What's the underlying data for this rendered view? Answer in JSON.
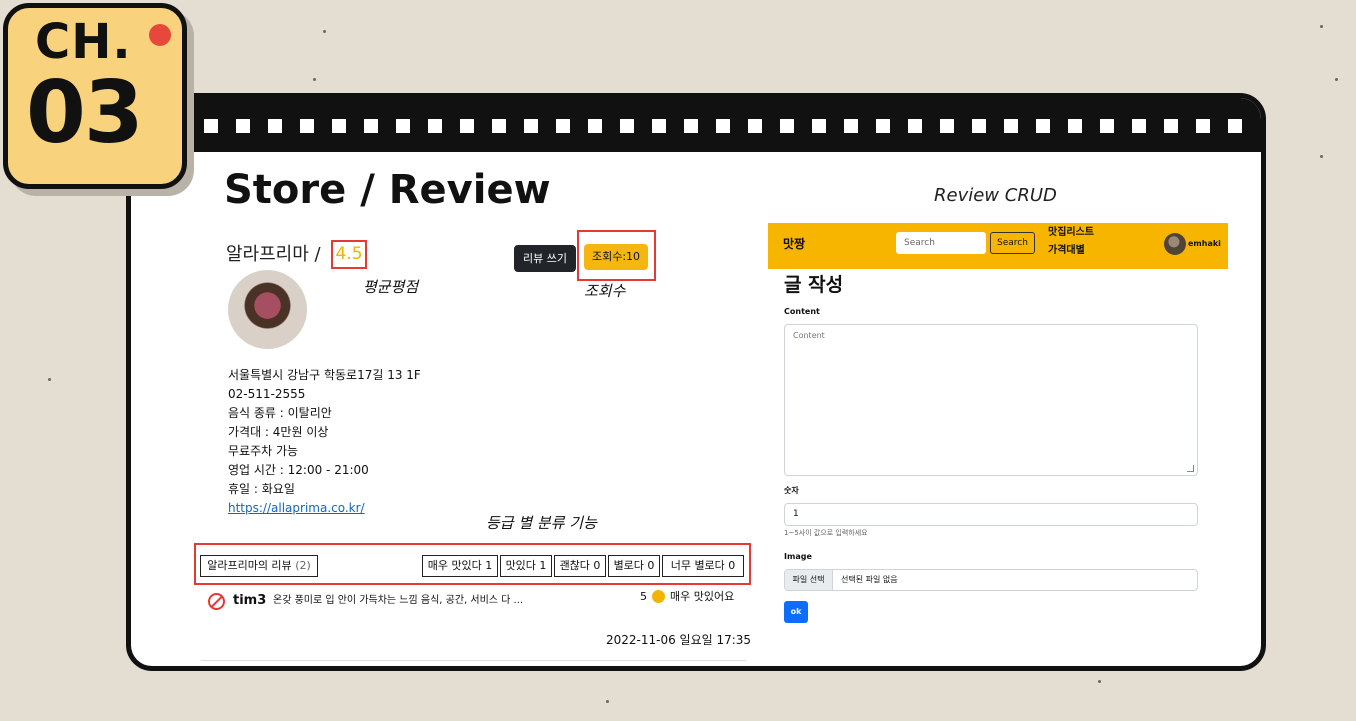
{
  "badge": {
    "chapter": "CH.",
    "number": "03"
  },
  "slide": {
    "title": "Store / Review",
    "crud_caption": "Review CRUD"
  },
  "store": {
    "name": "알라프리마 /",
    "rating": "4.5",
    "write_review_label": "리뷰 쓰기",
    "views_label": "조회수:10",
    "info": [
      "서울특별시 강남구 학동로17길 13 1F",
      "02-511-2555",
      "음식 종류 : 이탈리안",
      "가격대 : 4만원 이상",
      "무료주차 가능",
      "영업 시간 : 12:00 - 21:00",
      "휴일 : 화요일"
    ],
    "website": "https://allaprima.co.kr/"
  },
  "annotations": {
    "avg_rating": "평균평점",
    "views": "조회수",
    "grade_filter": "등급 별 분류 기능"
  },
  "reviews": {
    "header_label": "알라프리마의 리뷰",
    "header_count": "(2)",
    "tabs": [
      "매우 맛있다 1",
      "맛있다 1",
      "괜찮다 0",
      "별로다 0",
      "너무 별로다 0"
    ],
    "item": {
      "user": "tim3",
      "text": "온갖 풍미로 입 안이 가득차는 느낌 음식, 공간, 서비스 다 ...",
      "score": "5",
      "score_icon": "heart-eyes-emoji-icon",
      "label": "매우 맛있어요",
      "date": "2022-11-06 일요일 17:35"
    }
  },
  "write_page": {
    "nav": {
      "brand": "맛짱",
      "search_placeholder": "Search",
      "search_button": "Search",
      "menu": [
        "맛집리스트",
        "가격대별"
      ],
      "user": "emhaki"
    },
    "form_title": "글 작성",
    "content_label": "Content",
    "content_placeholder": "Content",
    "number_label": "숫자",
    "number_value": "1",
    "number_help": "1~5사이 값으로 입력하세요",
    "image_label": "Image",
    "file_button": "파일 선택",
    "file_status": "선택된 파일 없음",
    "submit": "ok"
  },
  "colors": {
    "background": "#e3ddd2",
    "badge_yellow": "#f8d27c",
    "badge_dot": "#e8473b",
    "nav_yellow": "#f8b500",
    "rating_yellow": "#f0b400",
    "highlight_red": "#e53935",
    "primary_blue": "#0d6efd"
  }
}
